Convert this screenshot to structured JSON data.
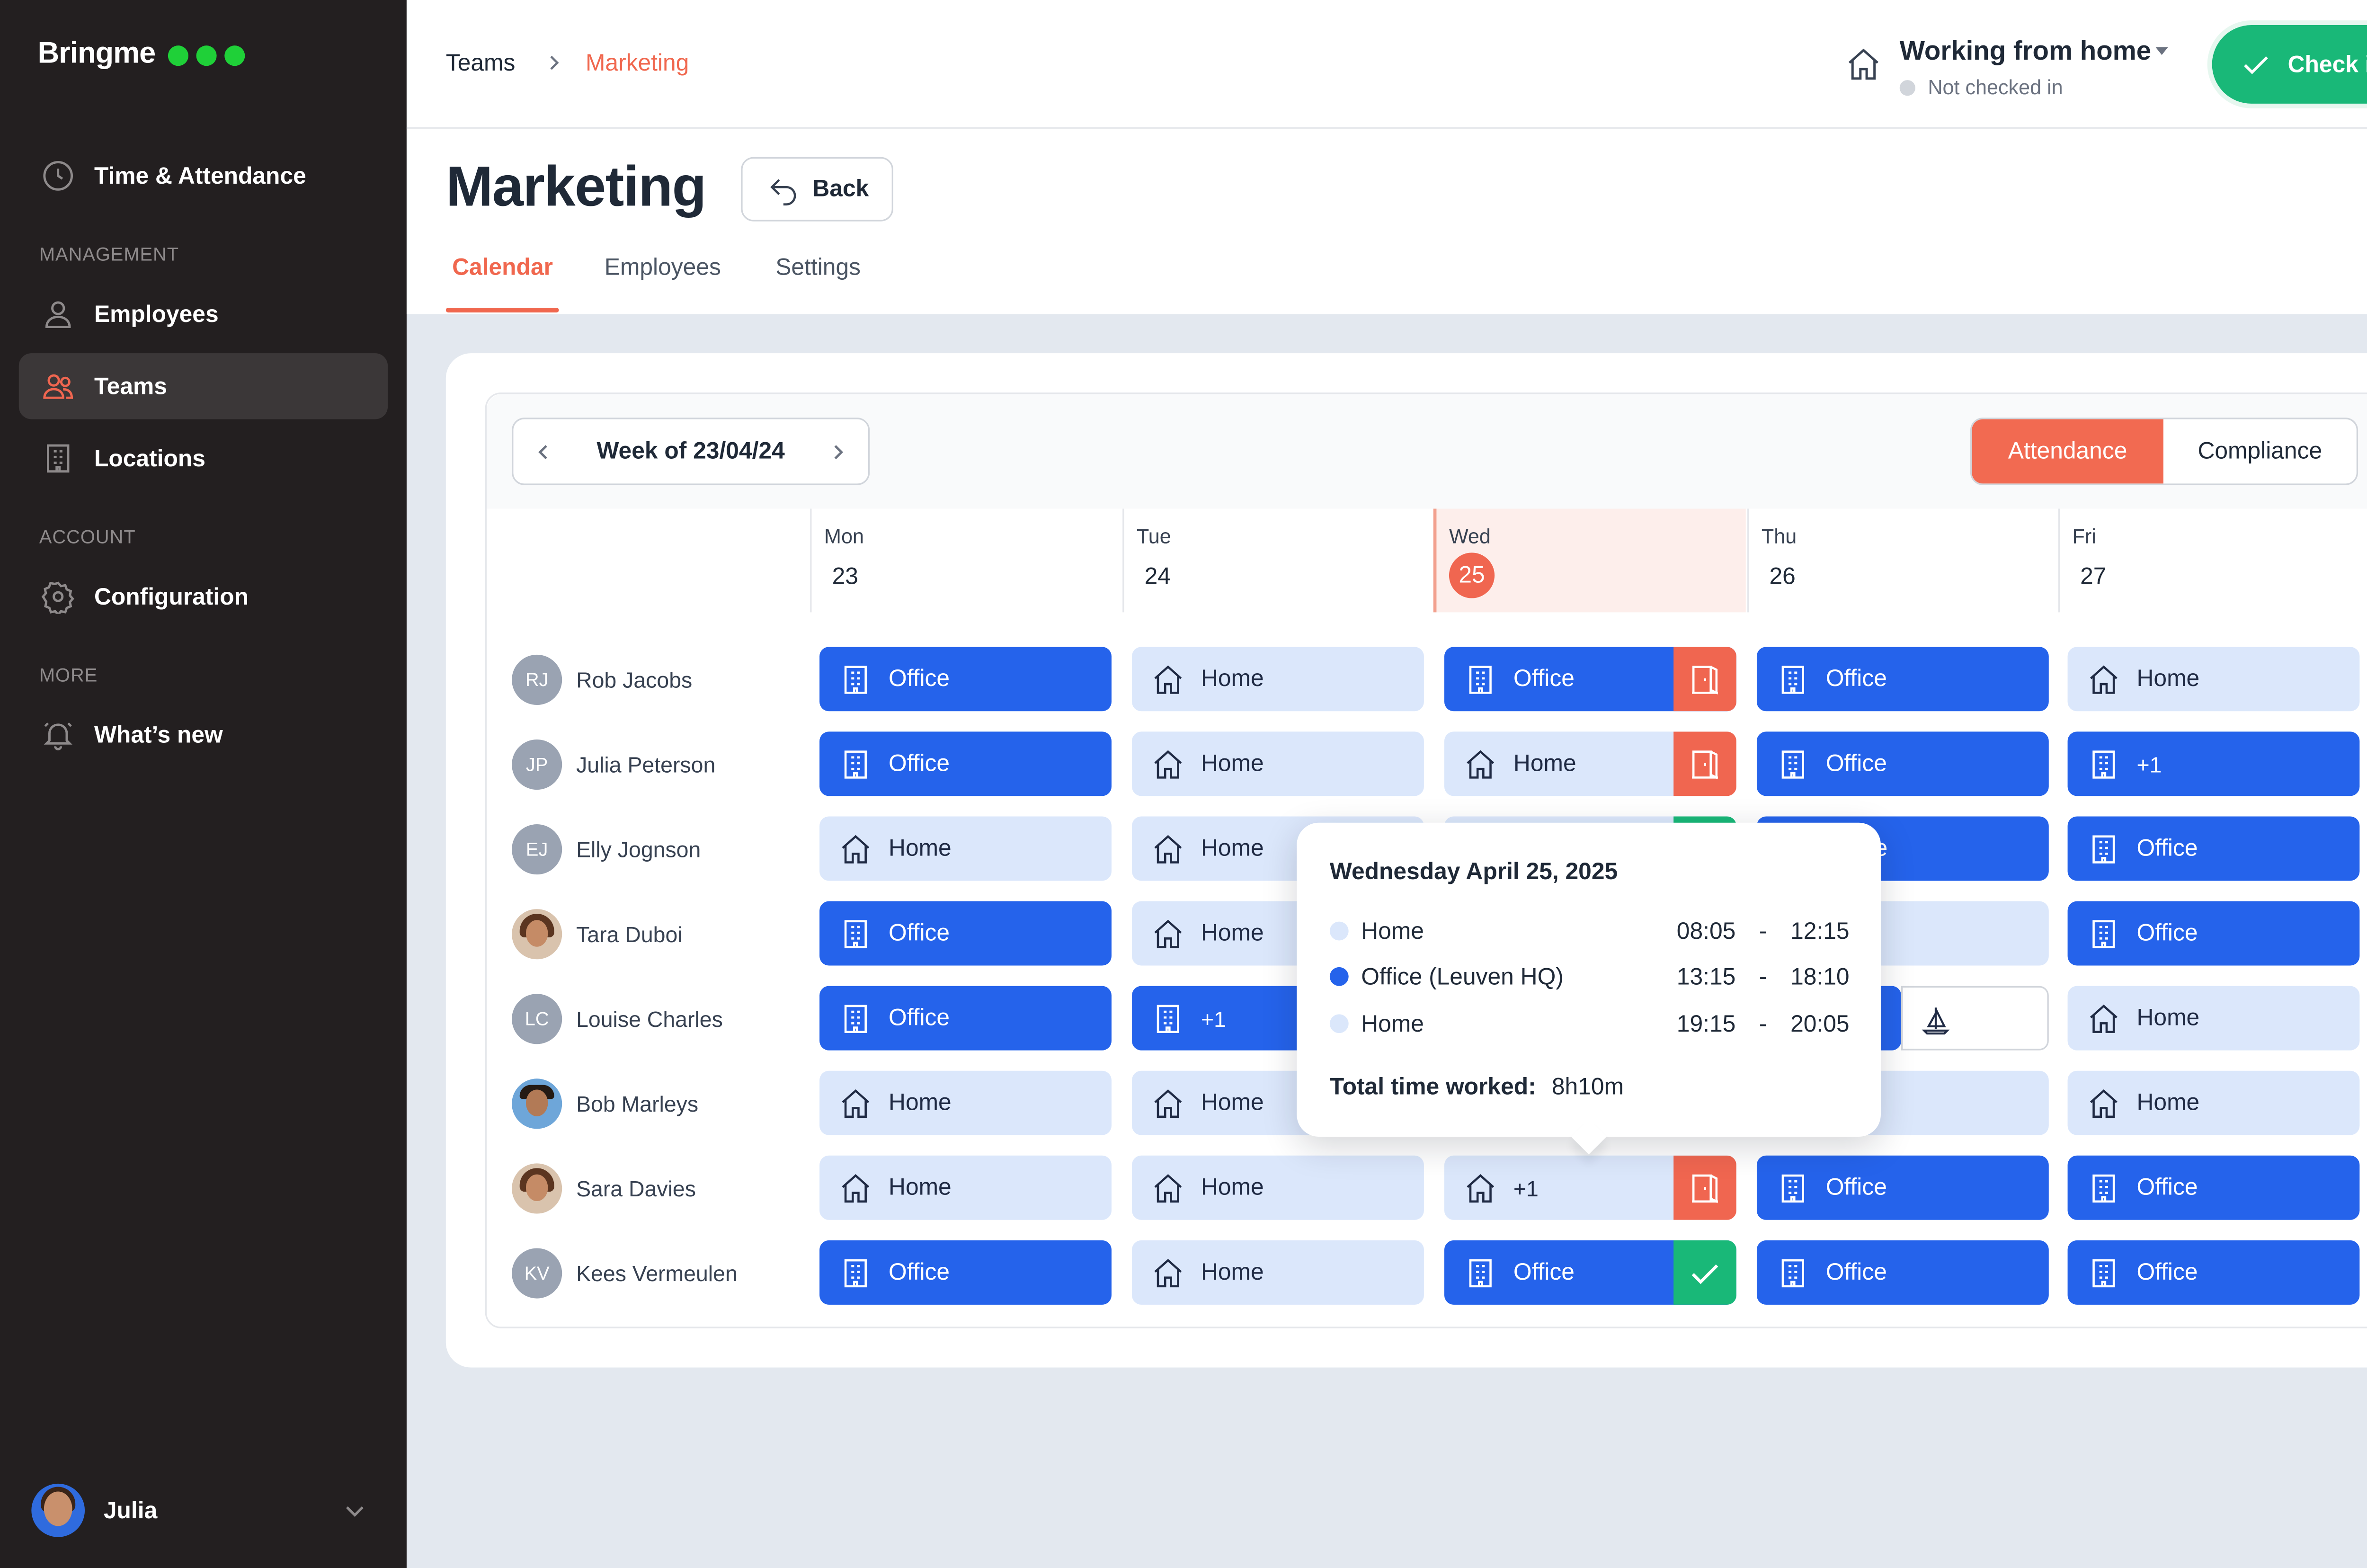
{
  "brand": {
    "name": "Bringme",
    "dot_color": "#1fd038"
  },
  "sidebar": {
    "top_item": {
      "label": "Time & Attendance",
      "icon": "clock-icon"
    },
    "sections": [
      {
        "label": "MANAGEMENT",
        "items": [
          {
            "label": "Employees",
            "icon": "user-icon"
          },
          {
            "label": "Teams",
            "icon": "users-icon",
            "active": true
          },
          {
            "label": "Locations",
            "icon": "building-icon"
          }
        ]
      },
      {
        "label": "ACCOUNT",
        "items": [
          {
            "label": "Configuration",
            "icon": "gear-icon"
          }
        ]
      },
      {
        "label": "MORE",
        "items": [
          {
            "label": "What’s new",
            "icon": "bell-icon"
          }
        ]
      }
    ],
    "user": {
      "name": "Julia"
    }
  },
  "breadcrumb": {
    "parent": "Teams",
    "current": "Marketing"
  },
  "status": {
    "title": "Working from home",
    "subtitle": "Not checked in",
    "checkin_label": "Check in"
  },
  "page": {
    "title": "Marketing",
    "back_label": "Back"
  },
  "tabs": [
    {
      "label": "Calendar",
      "active": true
    },
    {
      "label": "Employees"
    },
    {
      "label": "Settings"
    }
  ],
  "calendar": {
    "week_label": "Week of 23/04/24",
    "view_toggle": {
      "active": "Attendance",
      "inactive": "Compliance"
    },
    "days": [
      {
        "name": "Mon",
        "date": "23"
      },
      {
        "name": "Tue",
        "date": "24"
      },
      {
        "name": "Wed",
        "date": "25",
        "today": true
      },
      {
        "name": "Thu",
        "date": "26"
      },
      {
        "name": "Fri",
        "date": "27"
      }
    ],
    "rows": [
      {
        "initials": "RJ",
        "name": "Rob Jacobs"
      },
      {
        "initials": "JP",
        "name": "Julia Peterson"
      },
      {
        "initials": "EJ",
        "name": "Elly Jognson"
      },
      {
        "initials": "",
        "name": "Tara Duboi"
      },
      {
        "initials": "LC",
        "name": "Louise Charles"
      },
      {
        "initials": "",
        "name": "Bob Marleys"
      },
      {
        "initials": "",
        "name": "Sara Davies"
      },
      {
        "initials": "KV",
        "name": "Kees Vermeulen"
      }
    ],
    "labels": {
      "office": "Office",
      "home": "Home",
      "plus_one": "+1",
      "partial_office": "e"
    }
  },
  "tooltip": {
    "title": "Wednesday April 25, 2025",
    "entries": [
      {
        "label": "Home",
        "start": "08:05",
        "sep": "-",
        "end": "12:15"
      },
      {
        "label": "Office (Leuven HQ)",
        "start": "13:15",
        "sep": "-",
        "end": "18:10"
      },
      {
        "label": "Home",
        "start": "19:15",
        "sep": "-",
        "end": "20:05"
      }
    ],
    "total_label": "Total time worked:",
    "total_value": "8h10m"
  },
  "colors": {
    "accent": "#f06650",
    "office": "#2563eb",
    "home": "#dbe7fb",
    "checkin": "#19b878",
    "sidebar_bg": "#231f20"
  }
}
